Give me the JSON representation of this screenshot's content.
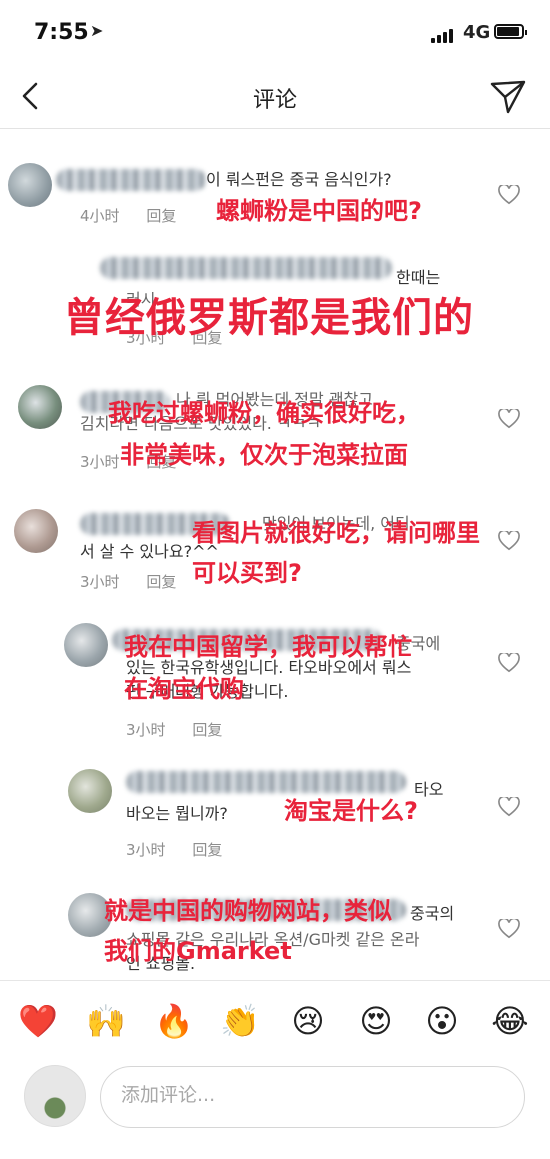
{
  "status": {
    "time": "7:55",
    "network": "4G"
  },
  "nav": {
    "title": "评论"
  },
  "comments": [
    {
      "text": [
        "이 뤄스펀은 중국 음식인가?"
      ],
      "time": "4小时",
      "reply": "回复",
      "overlay": [
        "螺蛳粉是中国的吧?"
      ]
    },
    {
      "text": [
        "한때는",
        "러시"
      ],
      "time": "3小时",
      "reply": "回复",
      "overlay": [
        "曾经俄罗斯都是我们的"
      ]
    },
    {
      "text": [
        "나 뤄 먹어봤는데 정말 괜찮고",
        "김치라면 다음으로 맛있었다. ㅋㅋㅋ"
      ],
      "time": "3小时",
      "reply": "回复",
      "overlay": [
        "我吃过螺蛳粉，确实很好吃，",
        "非常美味，仅次于泡菜拉面"
      ]
    },
    {
      "text": [
        "맛있어 보이는데, 어디",
        "서 살 수 있나요?^^"
      ],
      "time": "3小时",
      "reply": "回复",
      "overlay": [
        "看图片就很好吃，请问哪里",
        "可以买到?"
      ]
    },
    {
      "text": [
        "중국에",
        "있는 한국유학생입니다. 타오바오에서 뤄스",
        "펀 구매대행 가능합니다."
      ],
      "time": "3小时",
      "reply": "回复",
      "overlay": [
        "我在中国留学，我可以帮忙",
        "在淘宝代购"
      ]
    },
    {
      "text": [
        "타오",
        "바오는 뭡니까?"
      ],
      "time": "3小时",
      "reply": "回复",
      "overlay": [
        "淘宝是什么?"
      ]
    },
    {
      "text": [
        "중국의",
        "쇼핑몰 같은 우리나라 옥션/G마켓 같은 온라",
        "인 쇼핑몰."
      ],
      "time": "",
      "reply": "",
      "overlay": [
        "就是中国的购物网站，类似",
        "我们的Gmarket"
      ]
    }
  ],
  "emojis": [
    "❤️",
    "🙌",
    "🔥",
    "👏",
    "😢",
    "😍",
    "😮",
    "😂"
  ],
  "input": {
    "placeholder": "添加评论..."
  },
  "colors": {
    "overlay_red": "#e8233b",
    "meta_gray": "#8e8e8e"
  }
}
